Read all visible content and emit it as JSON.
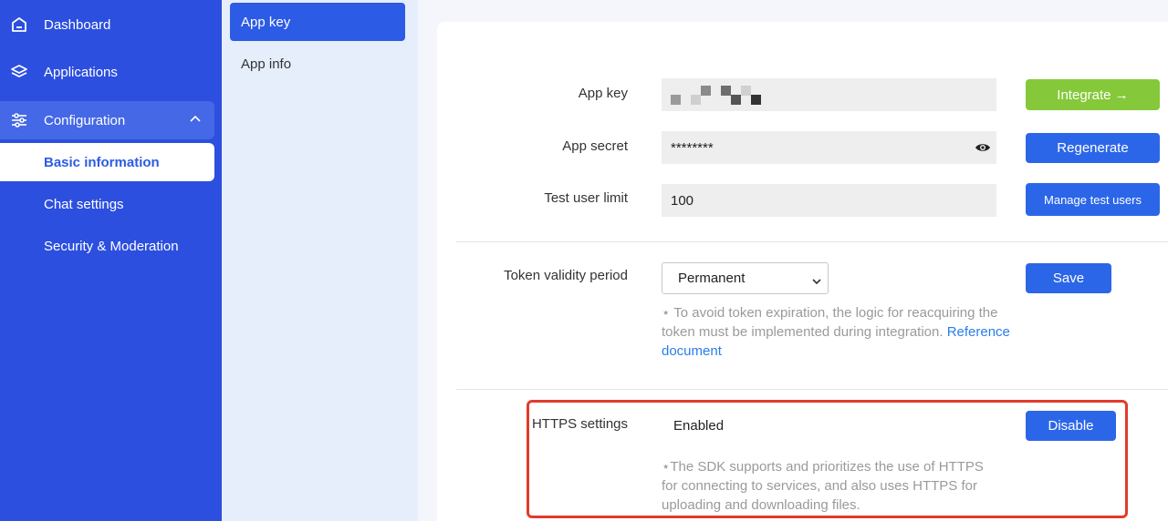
{
  "sidebar": {
    "items": [
      {
        "label": "Dashboard",
        "icon": "home-icon"
      },
      {
        "label": "Applications",
        "icon": "layers-icon"
      },
      {
        "label": "Configuration",
        "icon": "sliders-icon"
      }
    ],
    "subitems": [
      {
        "label": "Basic information",
        "active": true
      },
      {
        "label": "Chat settings"
      },
      {
        "label": "Security & Moderation"
      }
    ]
  },
  "subnav": {
    "items": [
      {
        "label": "App key",
        "active": true
      },
      {
        "label": "App info"
      }
    ]
  },
  "form": {
    "app_key": {
      "label": "App key",
      "value_masked": true,
      "button": "Integrate →"
    },
    "app_secret": {
      "label": "App secret",
      "value": "********",
      "button": "Regenerate"
    },
    "test_user_limit": {
      "label": "Test user limit",
      "value": "100",
      "button": "Manage test users"
    },
    "token": {
      "label": "Token validity period",
      "selected": "Permanent",
      "button": "Save",
      "note": "⋆ To avoid token expiration, the logic for reacquiring the token must be implemented during integration.",
      "link": "Reference document"
    },
    "https": {
      "label": "HTTPS settings",
      "status": "Enabled",
      "button": "Disable",
      "note": "⋆The SDK supports and prioritizes the use of HTTPS for connecting to services, and also uses HTTPS for uploading and downloading files."
    }
  },
  "colors": {
    "sidebar_bg": "#2c4fdf",
    "accent": "#2c66e8",
    "green": "#85c93a",
    "highlight_border": "#e23b2a"
  }
}
